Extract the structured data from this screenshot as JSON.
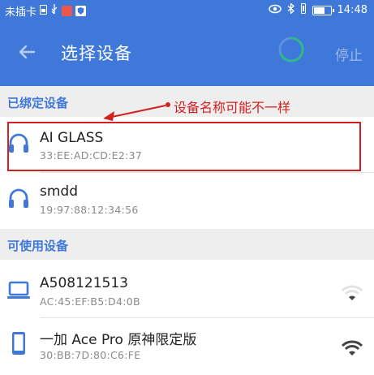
{
  "status_bar": {
    "carrier": "未插卡",
    "time": "14:48",
    "icons_left": [
      "sim-icon",
      "usb-icon",
      "mail-icon",
      "shield-app-icon"
    ],
    "icons_right": [
      "eye-icon",
      "bluetooth-icon",
      "mute-icon",
      "battery-icon"
    ]
  },
  "app_bar": {
    "title": "选择设备",
    "stop_label": "停止",
    "accent": "#3f78d9"
  },
  "bound_section": {
    "header": "已绑定设备",
    "devices": [
      {
        "name": "AI GLASS",
        "mac": "33:EE:AD:CD:E2:37",
        "icon": "headphones-icon"
      },
      {
        "name": "smdd",
        "mac": "19:97:88:12:34:56",
        "icon": "headphones-icon"
      }
    ]
  },
  "available_section": {
    "header": "可使用设备",
    "devices": [
      {
        "name": "A508121513",
        "mac": "AC:45:EF:B5:D4:0B",
        "icon": "laptop-icon",
        "signal": "weak"
      },
      {
        "name": "一加 Ace Pro 原神限定版",
        "mac": "30:BB:7D:80:C6:FE",
        "icon": "phone-icon",
        "signal": "strong"
      }
    ]
  },
  "annotation": {
    "text": "设备名称可能不一样",
    "color": "#d32020"
  }
}
